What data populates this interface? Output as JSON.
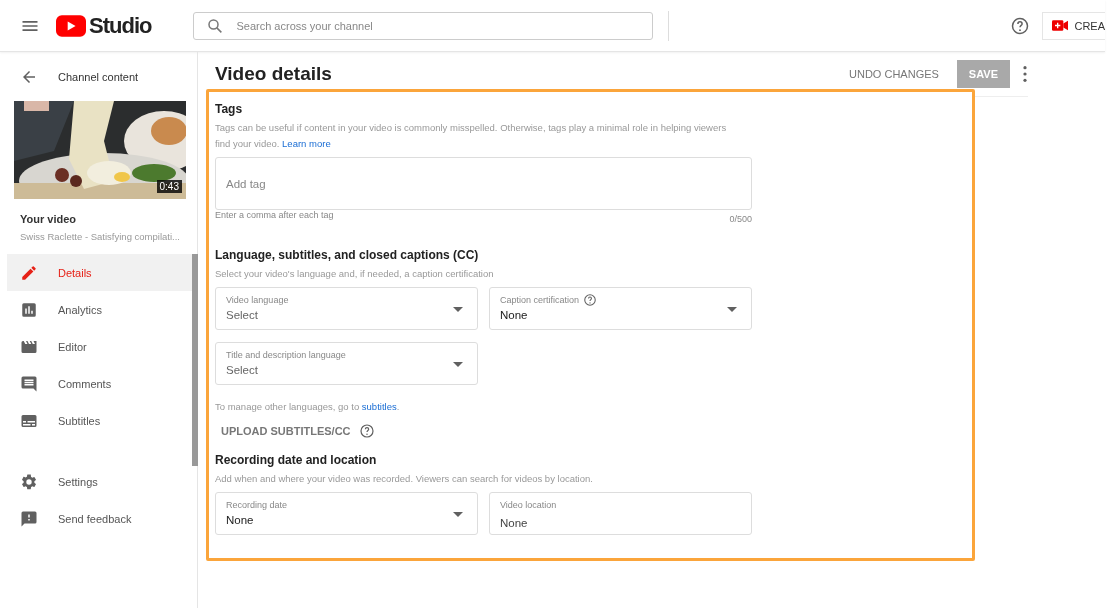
{
  "header": {
    "logo_text": "Studio",
    "search_placeholder": "Search across your channel",
    "create_label": "CREA"
  },
  "sidebar": {
    "back_label": "Channel content",
    "video": {
      "kind": "picture",
      "duration": "0:43",
      "heading": "Your video",
      "title": "Swiss Raclette - Satisfying compilati..."
    },
    "items": [
      {
        "label": "Details",
        "kind": "pencil",
        "selected": true
      },
      {
        "label": "Analytics",
        "kind": "chart",
        "selected": false
      },
      {
        "label": "Editor",
        "kind": "clapper",
        "selected": false
      },
      {
        "label": "Comments",
        "kind": "comment",
        "selected": false
      },
      {
        "label": "Subtitles",
        "kind": "subtitles",
        "selected": false
      }
    ],
    "footer_items": [
      {
        "label": "Settings",
        "kind": "gear"
      },
      {
        "label": "Send feedback",
        "kind": "feedback"
      }
    ]
  },
  "main": {
    "title": "Video details",
    "undo_label": "UNDO CHANGES",
    "save": {
      "label": "SAVE",
      "disabled": true
    },
    "tags": {
      "heading": "Tags",
      "description": "Tags can be useful if content in your video is commonly misspelled. Otherwise, tags play a minimal role in helping viewers find your video.",
      "link": "Learn more",
      "placeholder": "Add tag",
      "hint": "Enter a comma after each tag",
      "counter": "0/500"
    },
    "language": {
      "heading": "Language, subtitles, and closed captions (CC)",
      "description": "Select your video's language and, if needed, a caption certification",
      "fields": [
        {
          "label": "Video language",
          "value": "Select",
          "kind": "select",
          "help": false,
          "placeholder_style": true
        },
        {
          "label": "Caption certification",
          "value": "None",
          "kind": "select",
          "help": true,
          "placeholder_style": false
        },
        {
          "label": "Title and description language",
          "value": "Select",
          "kind": "select",
          "help": false,
          "placeholder_style": true
        }
      ],
      "manage_text": "To manage other languages, go to",
      "manage_link": "subtitles",
      "manage_end": ".",
      "upload_label": "UPLOAD SUBTITLES/CC"
    },
    "recording": {
      "heading": "Recording date and location",
      "description": "Add when and where your video was recorded. Viewers can search for videos by location.",
      "fields": [
        {
          "label": "Recording date",
          "value": "None",
          "kind": "select",
          "help": false,
          "placeholder_style": false
        },
        {
          "label": "Video location",
          "value": "None",
          "kind": "text",
          "help": false,
          "placeholder_style": false
        }
      ]
    }
  }
}
